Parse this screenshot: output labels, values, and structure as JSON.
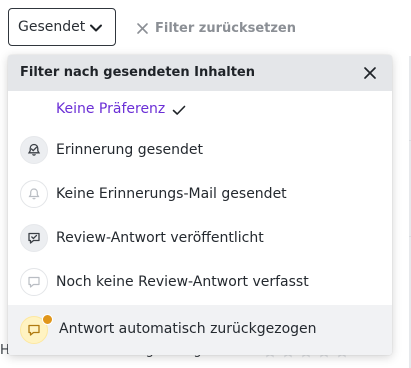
{
  "filter": {
    "select_value": "Gesendet",
    "reset_label": "Filter zurücksetzen"
  },
  "dropdown": {
    "title": "Filter nach gesendeten Inhalten",
    "options": [
      {
        "label": "Keine Präferenz",
        "icon": "none",
        "selected": true
      },
      {
        "label": "Erinnerung gesendet",
        "icon": "reminder-sent-icon"
      },
      {
        "label": "Keine Erinnerungs-Mail gesendet",
        "icon": "bell-icon"
      },
      {
        "label": "Review-Antwort veröffentlicht",
        "icon": "reply-published-icon"
      },
      {
        "label": "Noch keine Review-Antwort verfasst",
        "icon": "chat-bubble-icon"
      },
      {
        "label": "Antwort automatisch zurückgezogen",
        "icon": "chat-warning-icon"
      }
    ]
  },
  "background": {
    "row_initial": "H",
    "row_job": "Online Marketing Manager",
    "row_dash": "-"
  },
  "colors": {
    "selected_text": "#6b2fd6",
    "header_bg": "#e4e6e9",
    "warning": "#e0961a"
  }
}
